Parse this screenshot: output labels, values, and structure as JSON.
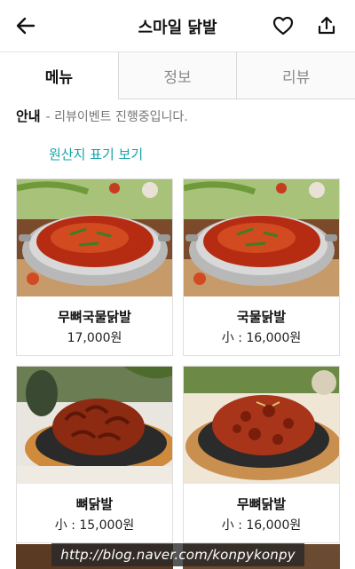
{
  "header": {
    "title": "스마일 닭발"
  },
  "tabs": [
    {
      "label": "메뉴",
      "active": true
    },
    {
      "label": "정보",
      "active": false
    },
    {
      "label": "리뷰",
      "active": false
    }
  ],
  "notice": {
    "label": "안내",
    "text": "- 리뷰이벤트 진행중입니다."
  },
  "origin_link": "원산지 표기 보기",
  "menu_items": [
    {
      "name": "무뼈국물닭발",
      "price": "17,000원",
      "image": "soup-chicken-feet-pot"
    },
    {
      "name": "국물닭발",
      "price": "小 : 16,000원",
      "image": "soup-chicken-feet-pot"
    },
    {
      "name": "뼈닭발",
      "price": "小 : 15,000원",
      "image": "grilled-chicken-feet-plate"
    },
    {
      "name": "무뼈닭발",
      "price": "小 : 16,000원",
      "image": "grilled-boneless-chicken-feet-plate"
    }
  ],
  "watermark": "http://blog.naver.com/konpykonpy",
  "colors": {
    "accent": "#17a3a6",
    "tab_border": "#d9d9d9"
  }
}
